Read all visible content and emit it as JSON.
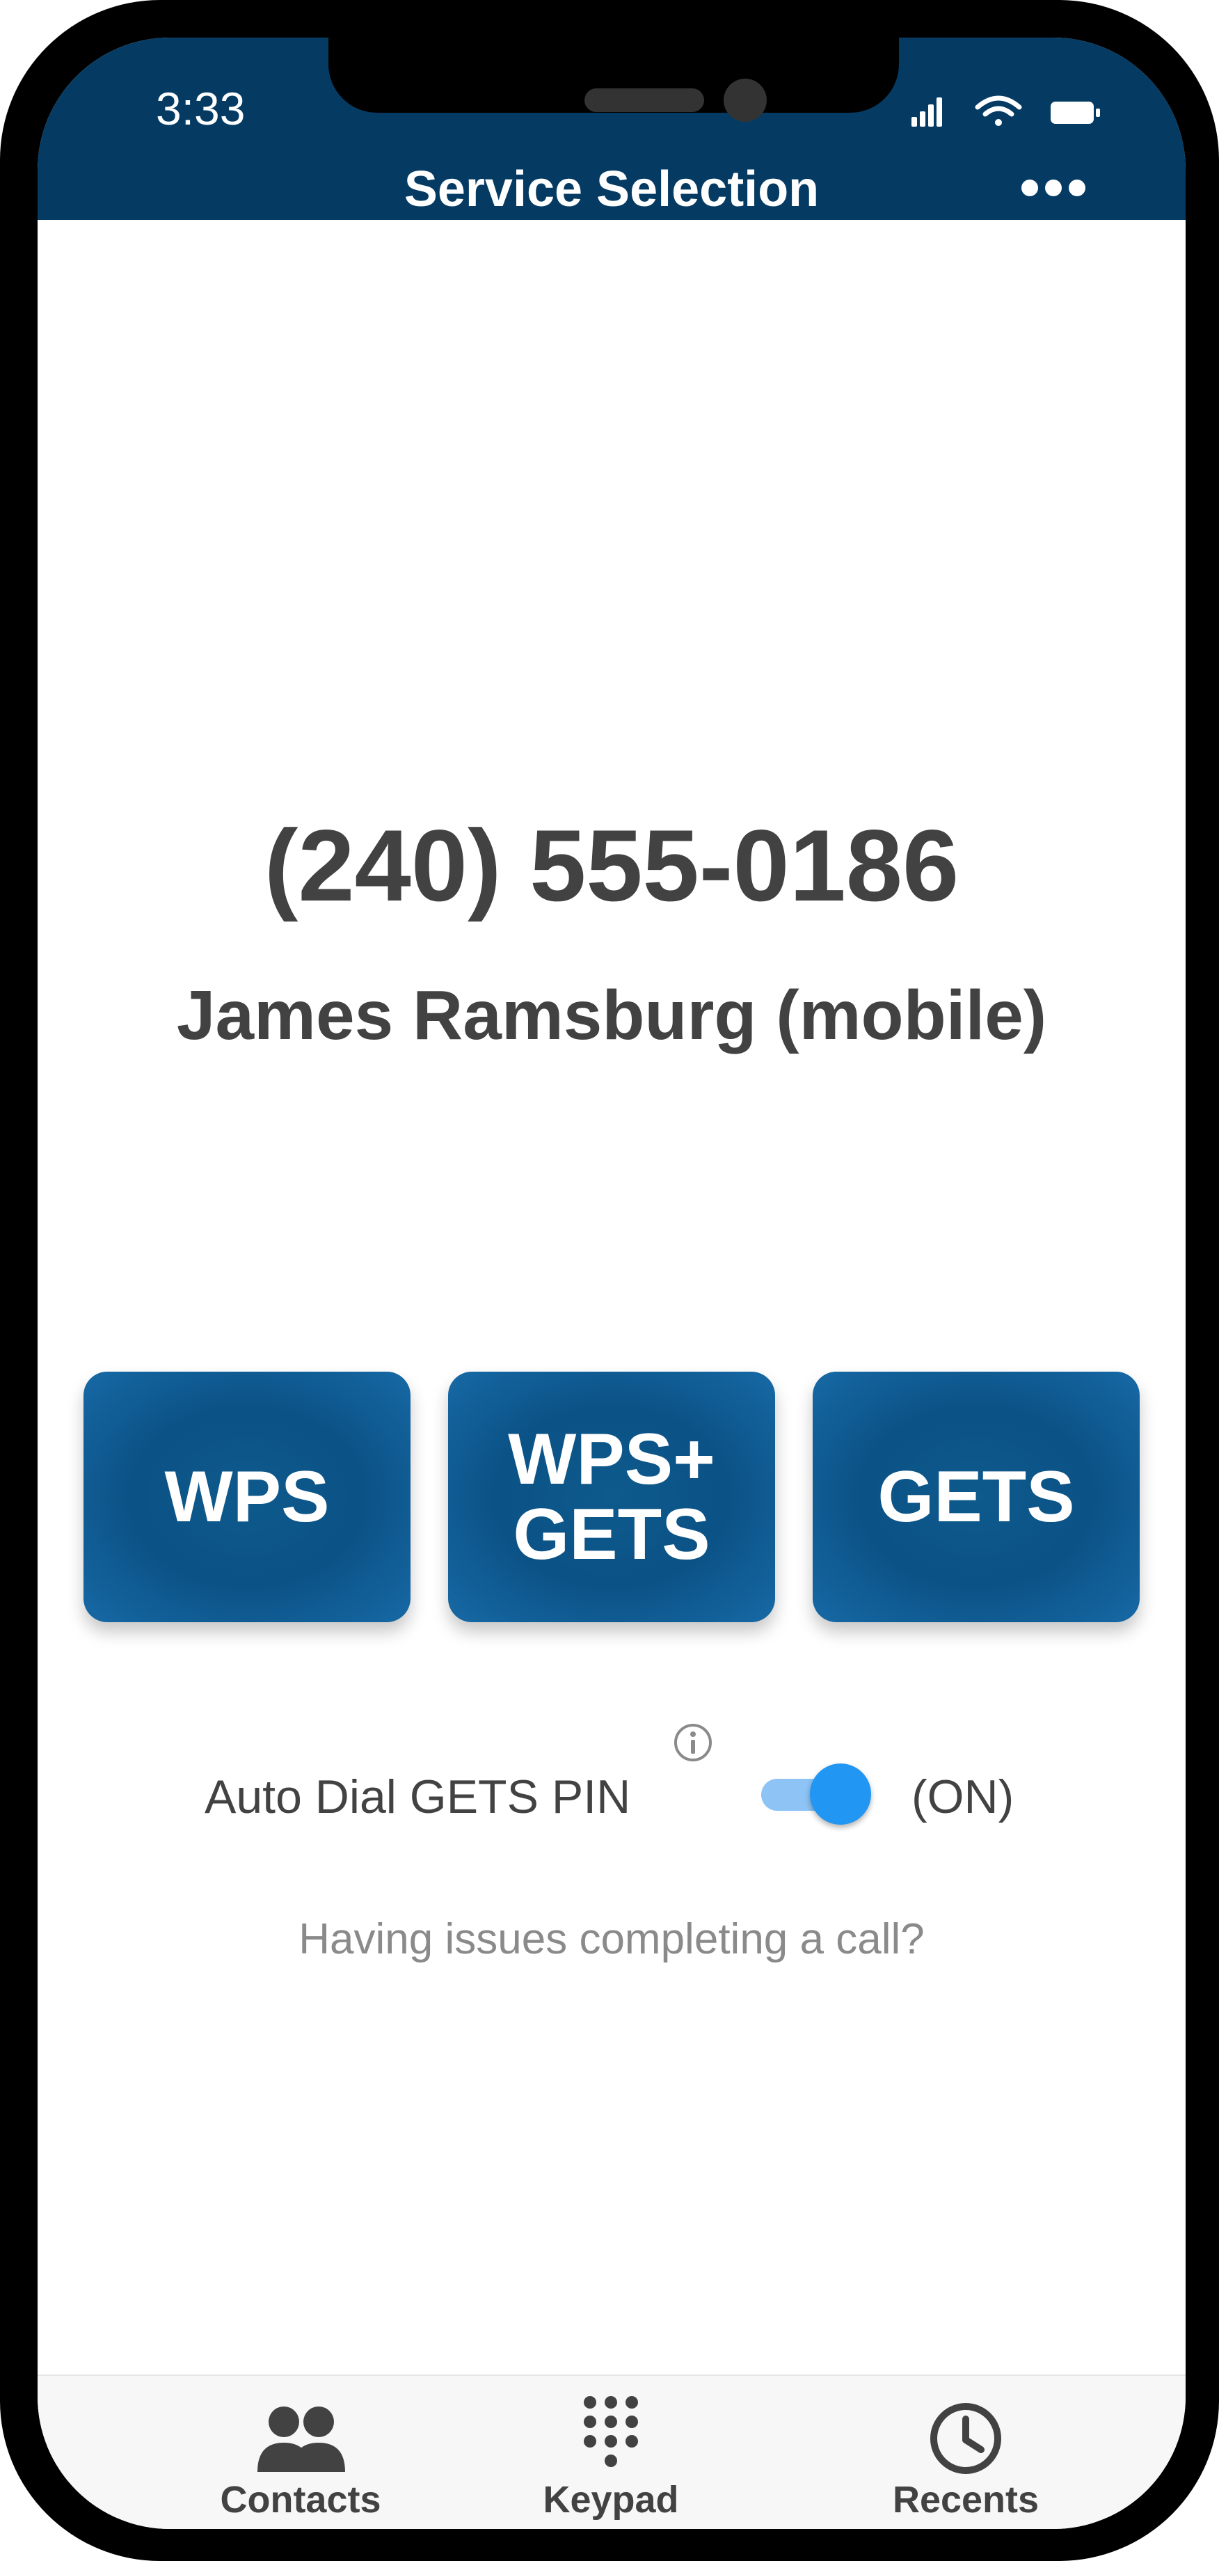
{
  "status_bar": {
    "time": "3:33",
    "icons": [
      "cellular-signal-icon",
      "wifi-icon",
      "battery-icon"
    ]
  },
  "header": {
    "title": "Service Selection",
    "more_icon": "more-horizontal-icon"
  },
  "call": {
    "phone_number": "(240) 555-0186",
    "contact_name": "James Ramsburg (mobile)"
  },
  "services": [
    {
      "label": "WPS"
    },
    {
      "label": "WPS+\nGETS"
    },
    {
      "label": "GETS"
    }
  ],
  "auto_dial": {
    "label": "Auto Dial GETS PIN",
    "info_icon": "info-icon",
    "enabled": true,
    "state_text": "(ON)"
  },
  "help": {
    "text": "Having issues completing a call?"
  },
  "tabs": [
    {
      "label": "Contacts",
      "icon": "contacts-icon"
    },
    {
      "label": "Keypad",
      "icon": "keypad-icon"
    },
    {
      "label": "Recents",
      "icon": "clock-icon"
    }
  ],
  "colors": {
    "header_bg": "#053b63",
    "button_bg": "#0b5286",
    "toggle_on": "#2196f3",
    "text_primary": "#424242",
    "text_muted": "#8a8a8a"
  }
}
